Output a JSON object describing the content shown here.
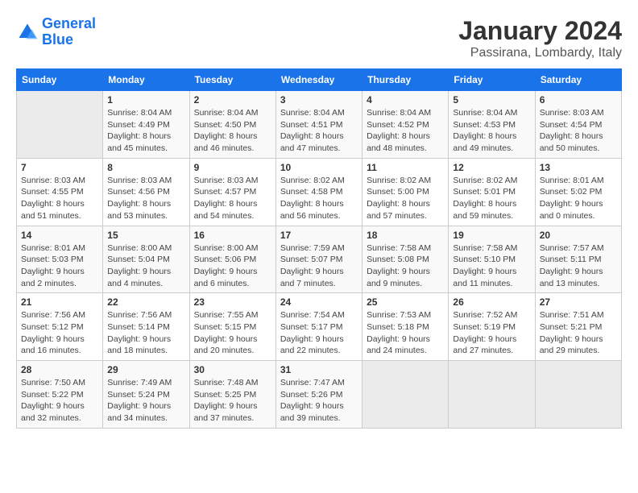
{
  "logo": {
    "line1": "General",
    "line2": "Blue"
  },
  "title": "January 2024",
  "subtitle": "Passirana, Lombardy, Italy",
  "days_of_week": [
    "Sunday",
    "Monday",
    "Tuesday",
    "Wednesday",
    "Thursday",
    "Friday",
    "Saturday"
  ],
  "weeks": [
    [
      {
        "day": "",
        "info": ""
      },
      {
        "day": "1",
        "info": "Sunrise: 8:04 AM\nSunset: 4:49 PM\nDaylight: 8 hours\nand 45 minutes."
      },
      {
        "day": "2",
        "info": "Sunrise: 8:04 AM\nSunset: 4:50 PM\nDaylight: 8 hours\nand 46 minutes."
      },
      {
        "day": "3",
        "info": "Sunrise: 8:04 AM\nSunset: 4:51 PM\nDaylight: 8 hours\nand 47 minutes."
      },
      {
        "day": "4",
        "info": "Sunrise: 8:04 AM\nSunset: 4:52 PM\nDaylight: 8 hours\nand 48 minutes."
      },
      {
        "day": "5",
        "info": "Sunrise: 8:04 AM\nSunset: 4:53 PM\nDaylight: 8 hours\nand 49 minutes."
      },
      {
        "day": "6",
        "info": "Sunrise: 8:03 AM\nSunset: 4:54 PM\nDaylight: 8 hours\nand 50 minutes."
      }
    ],
    [
      {
        "day": "7",
        "info": "Sunrise: 8:03 AM\nSunset: 4:55 PM\nDaylight: 8 hours\nand 51 minutes."
      },
      {
        "day": "8",
        "info": "Sunrise: 8:03 AM\nSunset: 4:56 PM\nDaylight: 8 hours\nand 53 minutes."
      },
      {
        "day": "9",
        "info": "Sunrise: 8:03 AM\nSunset: 4:57 PM\nDaylight: 8 hours\nand 54 minutes."
      },
      {
        "day": "10",
        "info": "Sunrise: 8:02 AM\nSunset: 4:58 PM\nDaylight: 8 hours\nand 56 minutes."
      },
      {
        "day": "11",
        "info": "Sunrise: 8:02 AM\nSunset: 5:00 PM\nDaylight: 8 hours\nand 57 minutes."
      },
      {
        "day": "12",
        "info": "Sunrise: 8:02 AM\nSunset: 5:01 PM\nDaylight: 8 hours\nand 59 minutes."
      },
      {
        "day": "13",
        "info": "Sunrise: 8:01 AM\nSunset: 5:02 PM\nDaylight: 9 hours\nand 0 minutes."
      }
    ],
    [
      {
        "day": "14",
        "info": "Sunrise: 8:01 AM\nSunset: 5:03 PM\nDaylight: 9 hours\nand 2 minutes."
      },
      {
        "day": "15",
        "info": "Sunrise: 8:00 AM\nSunset: 5:04 PM\nDaylight: 9 hours\nand 4 minutes."
      },
      {
        "day": "16",
        "info": "Sunrise: 8:00 AM\nSunset: 5:06 PM\nDaylight: 9 hours\nand 6 minutes."
      },
      {
        "day": "17",
        "info": "Sunrise: 7:59 AM\nSunset: 5:07 PM\nDaylight: 9 hours\nand 7 minutes."
      },
      {
        "day": "18",
        "info": "Sunrise: 7:58 AM\nSunset: 5:08 PM\nDaylight: 9 hours\nand 9 minutes."
      },
      {
        "day": "19",
        "info": "Sunrise: 7:58 AM\nSunset: 5:10 PM\nDaylight: 9 hours\nand 11 minutes."
      },
      {
        "day": "20",
        "info": "Sunrise: 7:57 AM\nSunset: 5:11 PM\nDaylight: 9 hours\nand 13 minutes."
      }
    ],
    [
      {
        "day": "21",
        "info": "Sunrise: 7:56 AM\nSunset: 5:12 PM\nDaylight: 9 hours\nand 16 minutes."
      },
      {
        "day": "22",
        "info": "Sunrise: 7:56 AM\nSunset: 5:14 PM\nDaylight: 9 hours\nand 18 minutes."
      },
      {
        "day": "23",
        "info": "Sunrise: 7:55 AM\nSunset: 5:15 PM\nDaylight: 9 hours\nand 20 minutes."
      },
      {
        "day": "24",
        "info": "Sunrise: 7:54 AM\nSunset: 5:17 PM\nDaylight: 9 hours\nand 22 minutes."
      },
      {
        "day": "25",
        "info": "Sunrise: 7:53 AM\nSunset: 5:18 PM\nDaylight: 9 hours\nand 24 minutes."
      },
      {
        "day": "26",
        "info": "Sunrise: 7:52 AM\nSunset: 5:19 PM\nDaylight: 9 hours\nand 27 minutes."
      },
      {
        "day": "27",
        "info": "Sunrise: 7:51 AM\nSunset: 5:21 PM\nDaylight: 9 hours\nand 29 minutes."
      }
    ],
    [
      {
        "day": "28",
        "info": "Sunrise: 7:50 AM\nSunset: 5:22 PM\nDaylight: 9 hours\nand 32 minutes."
      },
      {
        "day": "29",
        "info": "Sunrise: 7:49 AM\nSunset: 5:24 PM\nDaylight: 9 hours\nand 34 minutes."
      },
      {
        "day": "30",
        "info": "Sunrise: 7:48 AM\nSunset: 5:25 PM\nDaylight: 9 hours\nand 37 minutes."
      },
      {
        "day": "31",
        "info": "Sunrise: 7:47 AM\nSunset: 5:26 PM\nDaylight: 9 hours\nand 39 minutes."
      },
      {
        "day": "",
        "info": ""
      },
      {
        "day": "",
        "info": ""
      },
      {
        "day": "",
        "info": ""
      }
    ]
  ]
}
